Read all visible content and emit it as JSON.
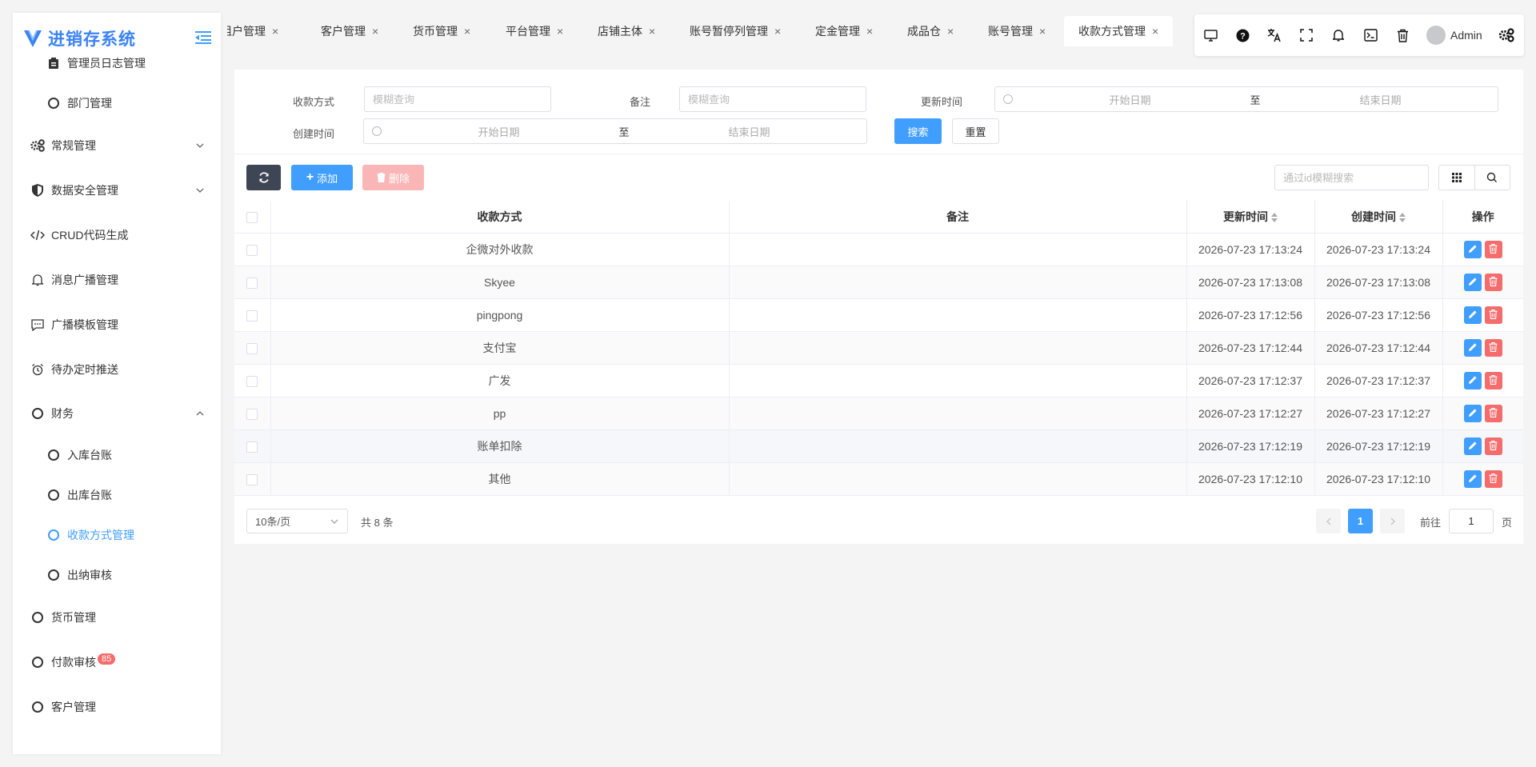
{
  "app": {
    "title": "进销存系统"
  },
  "sidebar": {
    "items": [
      {
        "label": "管理员日志管理",
        "icon": "clipboard-icon"
      },
      {
        "label": "部门管理",
        "icon": "circle-icon"
      },
      {
        "label": "常规管理",
        "icon": "gears-icon"
      },
      {
        "label": "数据安全管理",
        "icon": "shield-icon"
      },
      {
        "label": "CRUD代码生成",
        "icon": "code-icon"
      },
      {
        "label": "消息广播管理",
        "icon": "bell-icon"
      },
      {
        "label": "广播模板管理",
        "icon": "comment-icon"
      },
      {
        "label": "待办定时推送",
        "icon": "alarm-icon"
      },
      {
        "label": "财务",
        "icon": "circle-icon"
      },
      {
        "label": "入库台账",
        "icon": "circle-icon"
      },
      {
        "label": "出库台账",
        "icon": "circle-icon"
      },
      {
        "label": "收款方式管理",
        "icon": "circle-icon"
      },
      {
        "label": "出纳审核",
        "icon": "circle-icon"
      },
      {
        "label": "货币管理",
        "icon": "circle-icon"
      },
      {
        "label": "付款审核",
        "icon": "circle-icon",
        "badge": "85"
      },
      {
        "label": "客户管理",
        "icon": "circle-icon"
      }
    ]
  },
  "tabs": [
    {
      "label": "租户管理"
    },
    {
      "label": "客户管理"
    },
    {
      "label": "货币管理"
    },
    {
      "label": "平台管理"
    },
    {
      "label": "店铺主体"
    },
    {
      "label": "账号暂停列管理"
    },
    {
      "label": "定金管理"
    },
    {
      "label": "成品仓"
    },
    {
      "label": "账号管理"
    },
    {
      "label": "收款方式管理"
    }
  ],
  "topbar": {
    "user": "Admin"
  },
  "search": {
    "method_label": "收款方式",
    "method_placeholder": "模糊查询",
    "remark_label": "备注",
    "remark_placeholder": "模糊查询",
    "update_label": "更新时间",
    "created_label": "创建时间",
    "start_placeholder": "开始日期",
    "end_placeholder": "结束日期",
    "to": "至",
    "search_btn": "搜索",
    "reset_btn": "重置"
  },
  "toolbar": {
    "add_label": "添加",
    "delete_label": "删除",
    "id_search_placeholder": "通过id模糊搜索"
  },
  "table": {
    "headers": [
      "收款方式",
      "备注",
      "更新时间",
      "创建时间",
      "操作"
    ],
    "rows": [
      {
        "method": "企微对外收款",
        "remark": "",
        "updated": "2026-07-23 17:13:24",
        "created": "2026-07-23 17:13:24"
      },
      {
        "method": "Skyee",
        "remark": "",
        "updated": "2026-07-23 17:13:08",
        "created": "2026-07-23 17:13:08"
      },
      {
        "method": "pingpong",
        "remark": "",
        "updated": "2026-07-23 17:12:56",
        "created": "2026-07-23 17:12:56"
      },
      {
        "method": "支付宝",
        "remark": "",
        "updated": "2026-07-23 17:12:44",
        "created": "2026-07-23 17:12:44"
      },
      {
        "method": "广发",
        "remark": "",
        "updated": "2026-07-23 17:12:37",
        "created": "2026-07-23 17:12:37"
      },
      {
        "method": "pp",
        "remark": "",
        "updated": "2026-07-23 17:12:27",
        "created": "2026-07-23 17:12:27"
      },
      {
        "method": "账单扣除",
        "remark": "",
        "updated": "2026-07-23 17:12:19",
        "created": "2026-07-23 17:12:19"
      },
      {
        "method": "其他",
        "remark": "",
        "updated": "2026-07-23 17:12:10",
        "created": "2026-07-23 17:12:10"
      }
    ]
  },
  "pagination": {
    "page_size": "10条/页",
    "total": "共 8 条",
    "current": "1",
    "goto_prefix": "前往",
    "goto_value": "1",
    "goto_suffix": "页"
  },
  "colors": {
    "primary": "#409eff",
    "danger": "#f56c6c",
    "dark": "#3e4554"
  }
}
